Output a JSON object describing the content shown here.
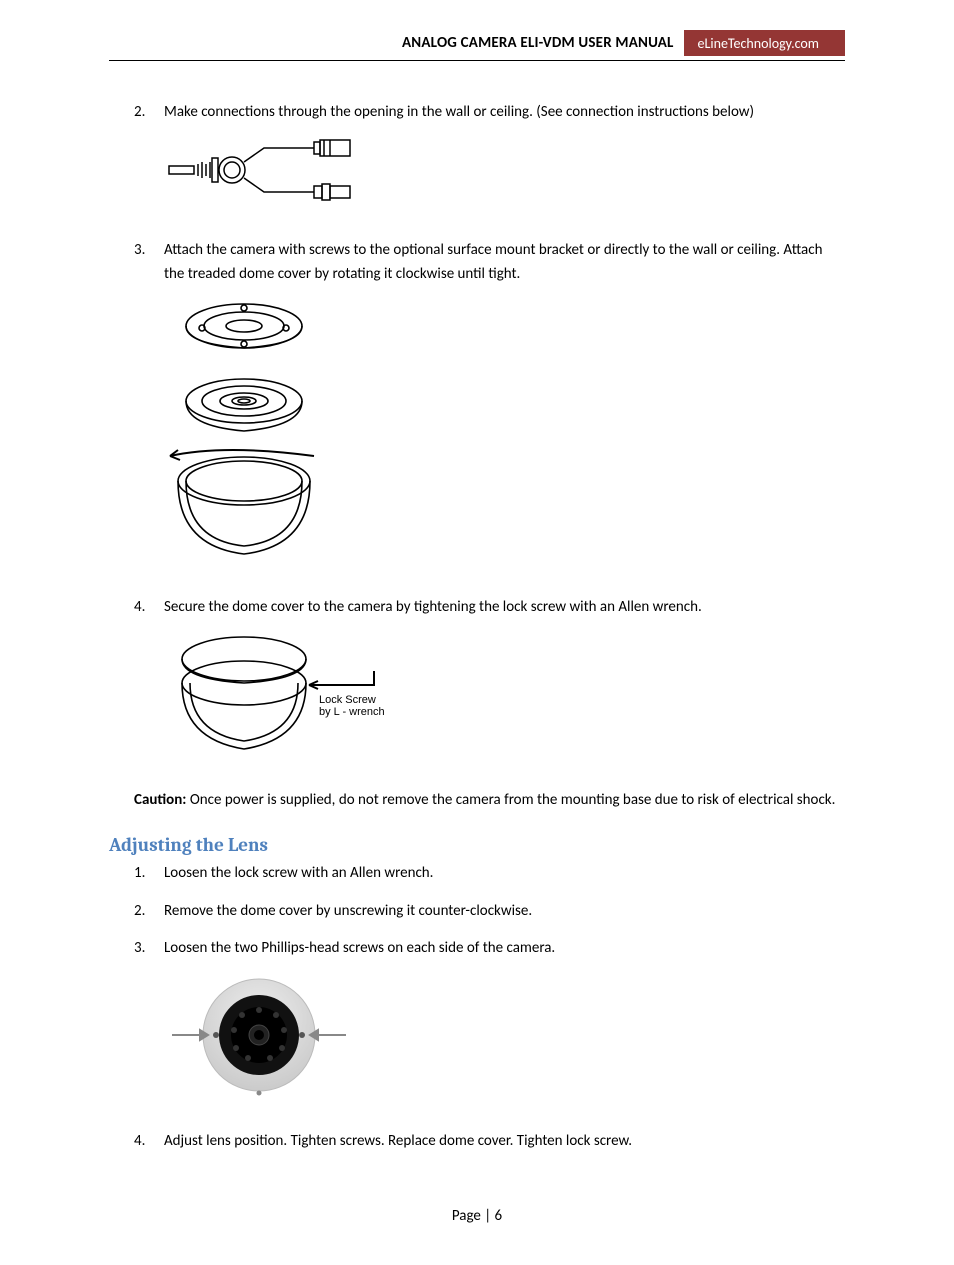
{
  "header": {
    "title": "ANALOG CAMERA ELI-VDM  USER MANUAL",
    "brand": "eLineTechnology.com"
  },
  "steps_top": [
    {
      "num": "2.",
      "text": "Make connections through the opening in the wall or ceiling. (See connection instructions below)"
    },
    {
      "num": "3.",
      "text": "Attach the camera with screws to the optional surface mount bracket or directly to the wall or ceiling. Attach the treaded dome cover by rotating it clockwise until tight."
    },
    {
      "num": "4.",
      "text": "Secure the dome cover to the camera by tightening the lock screw with an Allen wrench."
    }
  ],
  "caution": {
    "label": "Caution:",
    "text": " Once power is supplied, do not remove the camera from the mounting base due to risk of electrical shock."
  },
  "section_heading": "Adjusting the Lens",
  "steps_adjust": [
    {
      "num": "1.",
      "text": "Loosen the lock screw with an Allen wrench."
    },
    {
      "num": "2.",
      "text": "Remove the dome cover by unscrewing it counter-clockwise."
    },
    {
      "num": "3.",
      "text": "Loosen the two Phillips-head screws on each side of the camera."
    },
    {
      "num": "4.",
      "text": "Adjust lens position. Tighten screws. Replace dome cover. Tighten lock screw."
    }
  ],
  "figure_labels": {
    "lock_screw": "Lock Screw\nby L - wrench"
  },
  "footer": "Page | 6"
}
